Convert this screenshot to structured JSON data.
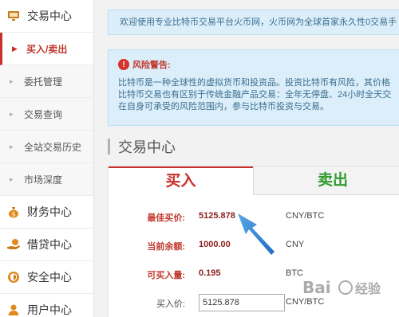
{
  "sidebar": {
    "trade_center": "交易中心",
    "buy_sell": "买入/卖出",
    "order_manage": "委托管理",
    "trade_query": "交易查询",
    "site_history": "全站交易历史",
    "market_depth": "市场深度",
    "finance_center": "财务中心",
    "loan_center": "借贷中心",
    "security_center": "安全中心",
    "user_center": "用户中心"
  },
  "welcome": "欢迎使用专业比特币交易平台火币网，火币网为全球首家永久性0交易手",
  "warning": {
    "title": "风险警告:",
    "line1": "比特币是一种全球性的虚拟货币和投资品。投资比特币有风险，其价格",
    "line2": "比特币交易也有区别于传统金融产品交易：全年无停盘、24小时全天交",
    "line3": "在自身可承受的风险范围内，参与比特币投资与交易。"
  },
  "section_title": "交易中心",
  "tabs": {
    "buy": "买入",
    "sell": "卖出"
  },
  "rows": {
    "best_price_label": "最佳买价:",
    "best_price_value": "5125.878",
    "best_price_unit": "CNY/BTC",
    "balance_label": "当前余额:",
    "balance_value": "1000.00",
    "balance_unit": "CNY",
    "buyable_label": "可买入量:",
    "buyable_value": "0.195",
    "buyable_unit": "BTC",
    "buy_price_label": "买入价:",
    "buy_price_value": "5125.878",
    "buy_price_unit": "CNY/BTC"
  },
  "watermark": "Bai 经验",
  "colors": {
    "accent_red": "#c9302c",
    "sell_green": "#2e9a2e",
    "info_bg": "#dbeefa",
    "arrow_blue": "#2f7fd0"
  }
}
